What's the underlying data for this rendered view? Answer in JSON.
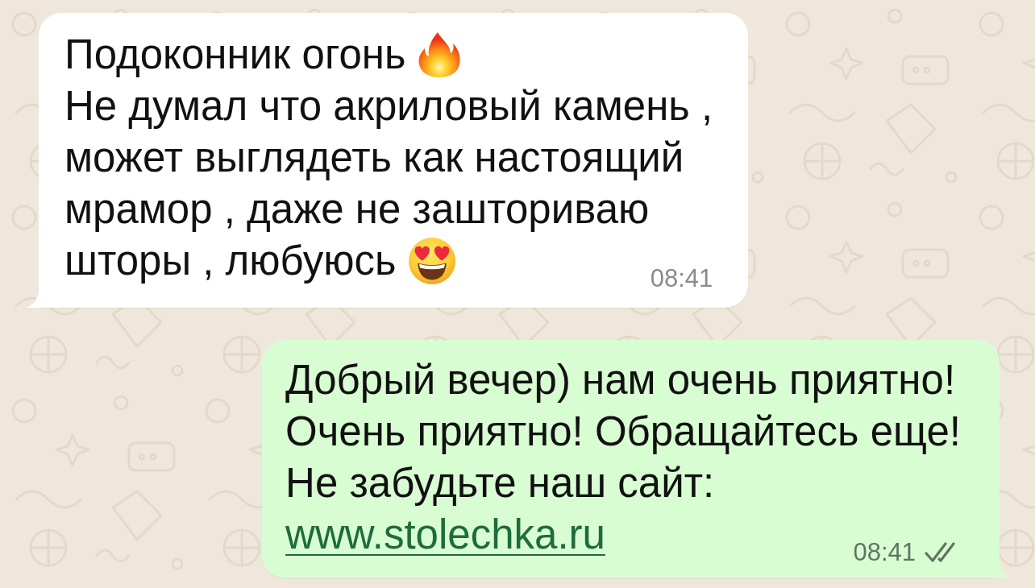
{
  "messages": [
    {
      "kind": "incoming",
      "lines": [
        {
          "kind": "text",
          "text": "Подоконник огонь",
          "emoji": {
            "kind": "fire"
          }
        },
        {
          "kind": "text",
          "text": "Не думал что акриловый камень ,"
        },
        {
          "kind": "text",
          "text": "может выглядеть как настоящий"
        },
        {
          "kind": "text",
          "text": "мрамор , даже не зашториваю"
        },
        {
          "kind": "text",
          "text": "шторы , любуюсь",
          "emoji": {
            "kind": "smitten"
          }
        }
      ],
      "time": "08:41"
    },
    {
      "kind": "outgoing",
      "lines": [
        {
          "kind": "text",
          "text": "Добрый вечер) нам очень приятно!"
        },
        {
          "kind": "text",
          "text": "Очень приятно! Обращайтесь еще!"
        },
        {
          "kind": "text",
          "text": "Не забудьте наш сайт:"
        },
        {
          "kind": "link",
          "text": "www.stolechka.ru"
        }
      ],
      "time": "08:41",
      "read": false
    }
  ]
}
